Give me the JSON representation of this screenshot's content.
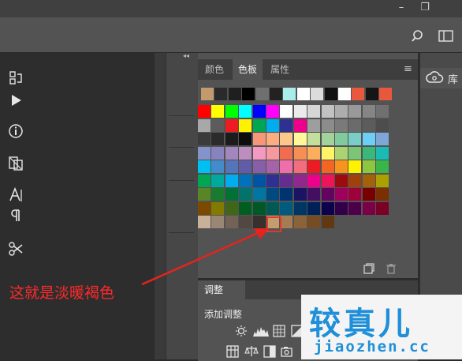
{
  "window": {
    "minimize": "–",
    "restore": "❐"
  },
  "toolbar": {
    "search_icon": "search-icon",
    "layout_icon": "workspace-icon"
  },
  "panels": {
    "collapse_left": "◂◂",
    "collapse_right": "▸▸",
    "tabs": [
      {
        "label": "颜色"
      },
      {
        "label": "色板"
      },
      {
        "label": "属性"
      }
    ],
    "active_tab": "色板",
    "menu_icon": "≡"
  },
  "swatches": {
    "recent": [
      "#c29a6b",
      "#2a2a2a",
      "#1f1f1f",
      "#000000",
      "#6f6f6f",
      "#222222",
      "#a8ecec",
      "#ffffff",
      "#dcdcdc",
      "#111111",
      "#ffffff",
      "#e8583c",
      "#151515",
      "#e8583c"
    ],
    "rows": [
      [
        "#ff0000",
        "#ffff00",
        "#00ff00",
        "#00ffff",
        "#0000ff",
        "#ff00ff",
        "#ffffff",
        "#ebebeb",
        "#d6d6d6",
        "#c2c2c2",
        "#adadad",
        "#999999",
        "#858585",
        "#707070"
      ],
      [
        "#a8a8a8",
        "#5c5c5c",
        "#ed1c24",
        "#fff200",
        "#00a651",
        "#00aeef",
        "#2e3192",
        "#ec008c",
        "#9e9e9e",
        "#8c8c8c",
        "#7a7a7a",
        "#6b6b6b",
        "#5c5c5c",
        "#4d4d4d"
      ],
      [
        "#3b3b3b",
        "#2b2b2b",
        "#1c1c1c",
        "#0d0d0d",
        "#f7977a",
        "#f9ad81",
        "#fdc68a",
        "#fff79a",
        "#c4df9b",
        "#a2d39c",
        "#82ca9d",
        "#7bcdc8",
        "#6ecff6",
        "#7ea7d8"
      ],
      [
        "#8493ca",
        "#8882be",
        "#a187be",
        "#bc8dbf",
        "#f49ac2",
        "#f6989d",
        "#f26c4f",
        "#f68e55",
        "#fbaf5c",
        "#fff467",
        "#acd372",
        "#7cc576",
        "#3bb878",
        "#1abbb4"
      ],
      [
        "#00bff3",
        "#438ccb",
        "#5574b9",
        "#605ca8",
        "#855fa8",
        "#a763a8",
        "#f06eaa",
        "#f26d7d",
        "#ed1c24",
        "#f26522",
        "#f7941d",
        "#fff200",
        "#8dc73f",
        "#39b54a"
      ],
      [
        "#00a651",
        "#00a99d",
        "#00aeef",
        "#0072bc",
        "#0054a6",
        "#2e3192",
        "#662d91",
        "#92278f",
        "#ec008c",
        "#ed145b",
        "#9e0b0f",
        "#a0410d",
        "#a36209",
        "#aba000"
      ],
      [
        "#598527",
        "#197b30",
        "#007236",
        "#00746b",
        "#0076a3",
        "#004a80",
        "#003471",
        "#1b1464",
        "#440e62",
        "#630460",
        "#9e005d",
        "#9e0039",
        "#790000",
        "#7b2e00"
      ],
      [
        "#7d4900",
        "#827b00",
        "#406618",
        "#005e20",
        "#005826",
        "#005952",
        "#005b7f",
        "#003663",
        "#002157",
        "#0d004c",
        "#32004b",
        "#4b0049",
        "#7b0046",
        "#7a0026"
      ],
      [
        "#c7b299",
        "#998675",
        "#736357",
        "#534741",
        "#37302d",
        "#c69c6d",
        "#a67c52",
        "#8c6239",
        "#754c24",
        "#603913"
      ]
    ],
    "highlighted_color": "#c69c6d"
  },
  "adjustments": {
    "tab_label": "调整",
    "add_label": "添加调整",
    "icons_row1": [
      "brightness-icon",
      "levels-icon",
      "curves-icon",
      "exposure-icon"
    ],
    "icons_row2": [
      "color-lookup-icon",
      "balance-icon",
      "black-white-icon",
      "photo-filter-icon"
    ]
  },
  "library": {
    "label": "库"
  },
  "annotation": {
    "text": "这就是淡暖褐色",
    "color": "#ff2a2a"
  },
  "watermark": {
    "title": "较真儿",
    "domain": "jiaozhen.cc",
    "color": "#1e8fd8"
  }
}
